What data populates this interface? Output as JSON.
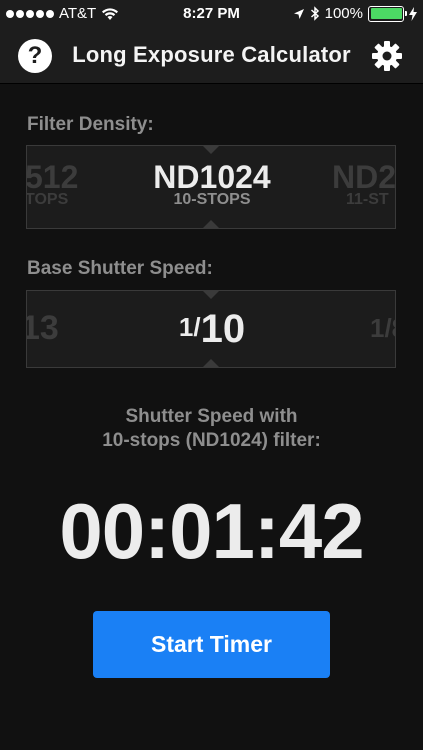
{
  "status_bar": {
    "carrier": "AT&T",
    "time": "8:27 PM",
    "battery_percent": "100%",
    "battery_level": 1.0
  },
  "nav": {
    "title": "Long Exposure Calculator",
    "help_icon": "?"
  },
  "filter_density": {
    "label": "Filter Density:",
    "prev": {
      "value": "512",
      "sub": "TOPS"
    },
    "current": {
      "value": "ND1024",
      "sub": "10-STOPS"
    },
    "next": {
      "value": "ND2",
      "sub": "11-ST"
    }
  },
  "base_shutter": {
    "label": "Base Shutter Speed:",
    "prev": "13",
    "current_numerator": "1/",
    "current_denominator": "10",
    "next": "1/8"
  },
  "result": {
    "caption_line1": "Shutter Speed with",
    "caption_line2": "10-stops (ND1024) filter:",
    "time": "00:01:42"
  },
  "start_button_label": "Start Timer",
  "colors": {
    "background": "#111111",
    "bar": "#1d1d1d",
    "accent": "#1a80f5",
    "label_gray": "#8e8e8e",
    "battery_green": "#4cd964"
  }
}
